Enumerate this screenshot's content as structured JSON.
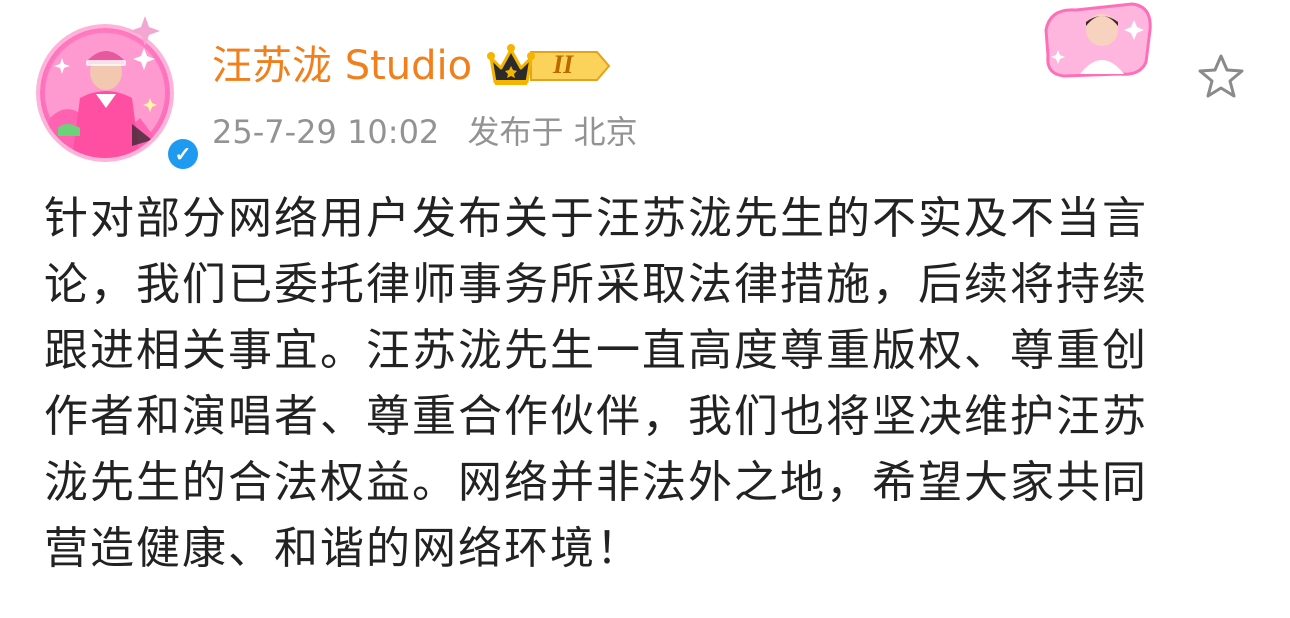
{
  "post": {
    "author": {
      "name": "汪苏泷 Studio",
      "level_badge": "II",
      "verified": true
    },
    "meta": {
      "date": "25-7-29 10:02",
      "location": "发布于 北京"
    },
    "content_lines": [
      "针对部分网络用户发布关于汪苏泷先生的不实及不当言",
      "论，我们已委托律师事务所采取法律措施，后续将持续",
      "跟进相关事宜。汪苏泷先生一直高度尊重版权、尊重创",
      "作者和演唱者、尊重合作伙伴，我们也将坚决维护汪苏",
      "泷先生的合法权益。网络并非法外之地，希望大家共同",
      "营造健康、和谐的网络环境！"
    ]
  },
  "colors": {
    "username": "#f07f1c",
    "meta_text": "#939393",
    "body_text": "#222222",
    "verified_blue": "#1e9bf0",
    "avatar_pink": "#ff7cc2",
    "badge_gold": "#f4b400"
  },
  "icons": {
    "verified": "verified-v-icon",
    "crown": "crown-icon",
    "favorite": "star-outline-icon"
  }
}
